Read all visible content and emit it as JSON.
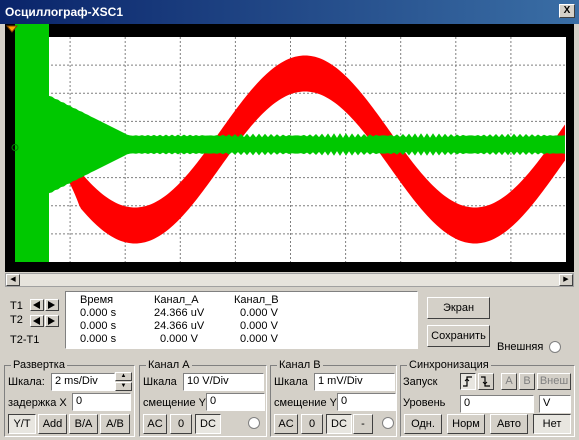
{
  "window": {
    "title": "Осциллограф-XSC1",
    "close_label": "X"
  },
  "colors": {
    "channel_a": "#ff0000",
    "channel_b": "#00c800",
    "grid": "#7f7f7f",
    "background": "#000000"
  },
  "cursors": {
    "t1_label": "T1",
    "t2_label": "T2",
    "t2t1_label": "T2-T1"
  },
  "measurements": {
    "headers": [
      "Время",
      "Канал_A",
      "Канал_B"
    ],
    "rows": [
      [
        "0.000 s",
        "24.366 uV",
        "0.000 V"
      ],
      [
        "0.000 s",
        "24.366 uV",
        "0.000 V"
      ],
      [
        "0.000 s",
        "0.000 V",
        "0.000 V"
      ]
    ]
  },
  "actions": {
    "screen_label": "Экран",
    "save_label": "Сохранить",
    "external_label": "Внешняя"
  },
  "timebase": {
    "title": "Развертка",
    "scale_label": "Шкала:",
    "scale_value": "2 ms/Div",
    "delay_label": "задержка X",
    "delay_value": "0",
    "buttons": [
      "Y/T",
      "Add",
      "B/A",
      "A/B"
    ]
  },
  "channel_a": {
    "title": "Канал A",
    "scale_label": "Шкала",
    "scale_value": "10  V/Div",
    "offset_label": "смещение Y",
    "offset_value": "0",
    "buttons": [
      "AC",
      "0",
      "DC"
    ]
  },
  "channel_b": {
    "title": "Канал B",
    "scale_label": "Шкала",
    "scale_value": "1 mV/Div",
    "offset_label": "смещение Y",
    "offset_value": "0",
    "buttons": [
      "AC",
      "0",
      "DC",
      "-"
    ]
  },
  "trigger": {
    "title": "Синхронизация",
    "edge_label": "Запуск",
    "level_label": "Уровень",
    "level_value": "0",
    "level_unit": "V",
    "source_buttons": [
      "A",
      "B",
      "Внеш"
    ],
    "mode_buttons": [
      "Одн.",
      "Норм",
      "Авто",
      "Нет"
    ]
  }
}
